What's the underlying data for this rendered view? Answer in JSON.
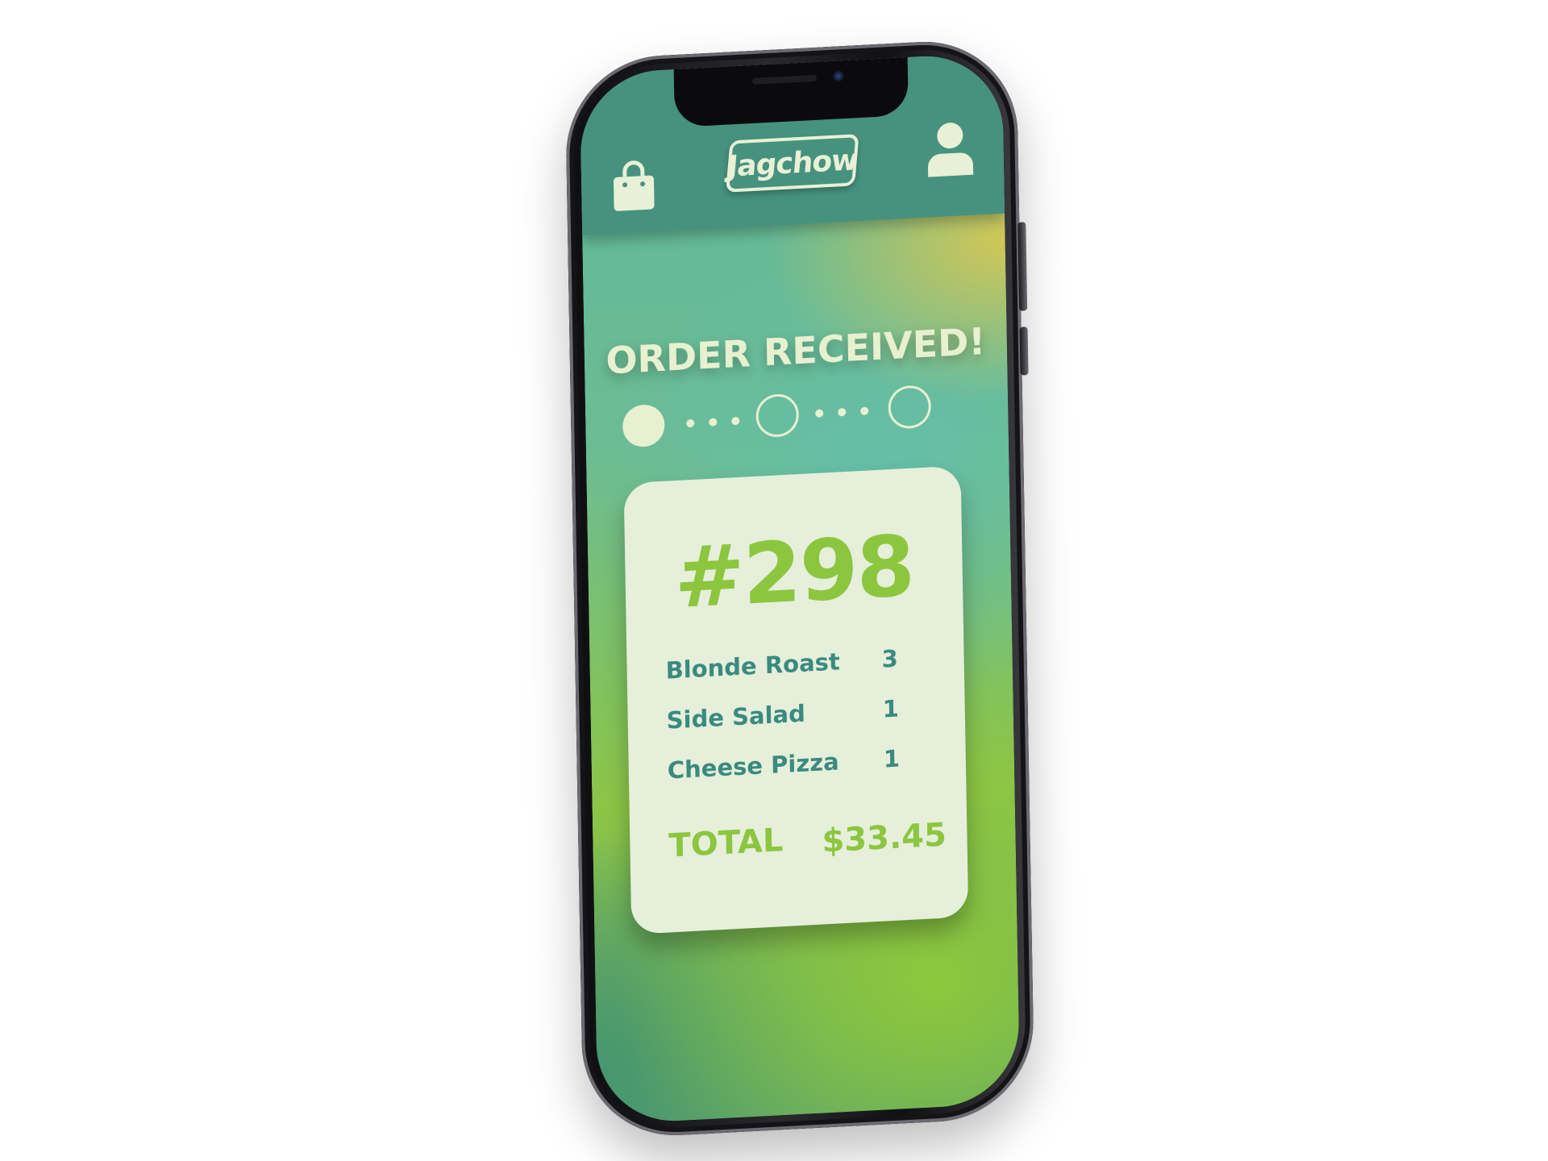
{
  "app": {
    "logo_text": "Jagchow"
  },
  "status": {
    "title": "ORDER RECEIVED!",
    "step_current": 1,
    "step_total": 3
  },
  "order": {
    "number": "#298",
    "items": [
      {
        "name": "Blonde Roast",
        "qty": "3"
      },
      {
        "name": "Side Salad",
        "qty": "1"
      },
      {
        "name": "Cheese Pizza",
        "qty": "1"
      }
    ],
    "total_label": "TOTAL",
    "total_value": "$33.45"
  },
  "icons": {
    "left": "shopping-bag-icon",
    "right": "user-icon"
  },
  "colors": {
    "header": "#46927f",
    "accent_green": "#8cc63f",
    "teal_text": "#3b8a80",
    "cream": "#e7f0cf",
    "card": "#e5efda"
  }
}
